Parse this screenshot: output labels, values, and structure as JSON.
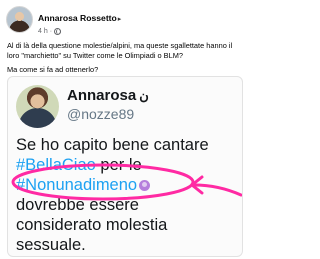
{
  "post": {
    "author": "Annarosa Rossetto",
    "author_arrow": "▸",
    "time": "4 h",
    "separator": "·",
    "paragraph_1": "Al di là  della questione molestie/alpini, ma queste sgallettate hanno il loro \"marchietto\" su Twitter come le Olimpiadi o BLM?",
    "paragraph_2": "Ma come si fa ad ottenerlo?"
  },
  "tweet": {
    "name": "Annarosa",
    "name_rtl": "ن",
    "handle": "@nozze89",
    "line1": "Se ho capito bene cantare",
    "hashtag1": "#BellaCiao",
    "after_hashtag1": " per le",
    "hashtag2": "#Nonunadimeno",
    "line3": "dovrebbe essere",
    "line4": "considerato molestia",
    "line5": "sessuale."
  },
  "colors": {
    "hashtag": "#1da1f2",
    "annotation": "#ff2aa3",
    "emoji": "#b57edc"
  },
  "icons": {
    "globe": "globe-icon",
    "emoji": "purple-emoji-icon",
    "annotation": "hand-drawn-circle-arrow"
  }
}
